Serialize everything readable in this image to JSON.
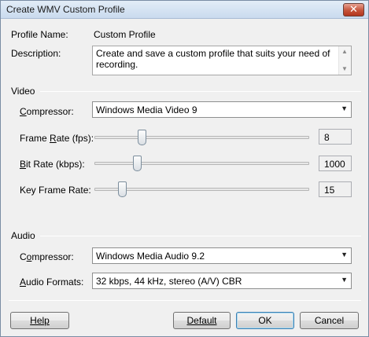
{
  "window": {
    "title": "Create WMV Custom Profile",
    "close_glyph": "✕"
  },
  "profile": {
    "name_label": "Profile Name:",
    "name_value": "Custom Profile",
    "desc_label": "Description:",
    "desc_value": "Create and save a custom profile that suits your need of recording."
  },
  "video": {
    "section_label": "Video",
    "compressor_label": "Compressor:",
    "compressor_value": "Windows Media Video 9",
    "sliders": [
      {
        "label": "Frame Rate (fps):",
        "value": "8",
        "level": 0.22
      },
      {
        "label": "Bit Rate (kbps):",
        "value": "1000",
        "level": 0.2
      },
      {
        "label": "Key Frame Rate:",
        "value": "15",
        "level": 0.13
      }
    ]
  },
  "audio": {
    "section_label": "Audio",
    "compressor_label": "Compressor:",
    "compressor_value": "Windows Media Audio 9.2",
    "formats_label": "Audio Formats:",
    "formats_value": "32 kbps, 44 kHz, stereo (A/V) CBR"
  },
  "buttons": {
    "help": "Help",
    "default": "Default",
    "ok": "OK",
    "cancel": "Cancel"
  },
  "icons": {
    "dropdown": "chevron-down-icon",
    "scroll_up": "arrow-up-icon",
    "scroll_down": "arrow-down-icon"
  }
}
